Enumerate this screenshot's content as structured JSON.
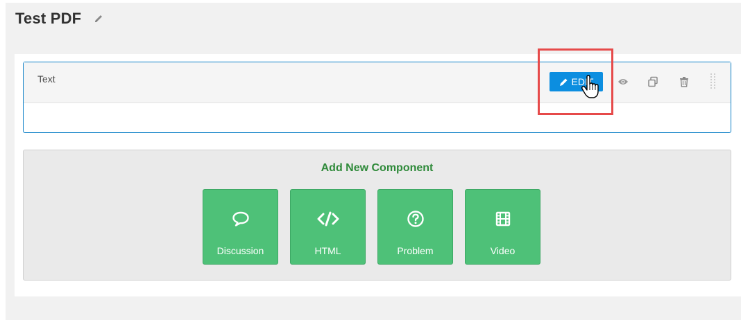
{
  "page": {
    "title": "Test PDF"
  },
  "component": {
    "title": "Text",
    "edit_label": "EDIT"
  },
  "add_new": {
    "title": "Add New Component",
    "buttons": [
      {
        "label": "Discussion",
        "icon": "discussion-icon"
      },
      {
        "label": "HTML",
        "icon": "code-icon"
      },
      {
        "label": "Problem",
        "icon": "question-icon"
      },
      {
        "label": "Video",
        "icon": "film-icon"
      }
    ]
  },
  "colors": {
    "accent_blue": "#0c8ee0",
    "green": "#4ec178",
    "green_text": "#2f8a3a",
    "highlight": "#e64a4a"
  }
}
